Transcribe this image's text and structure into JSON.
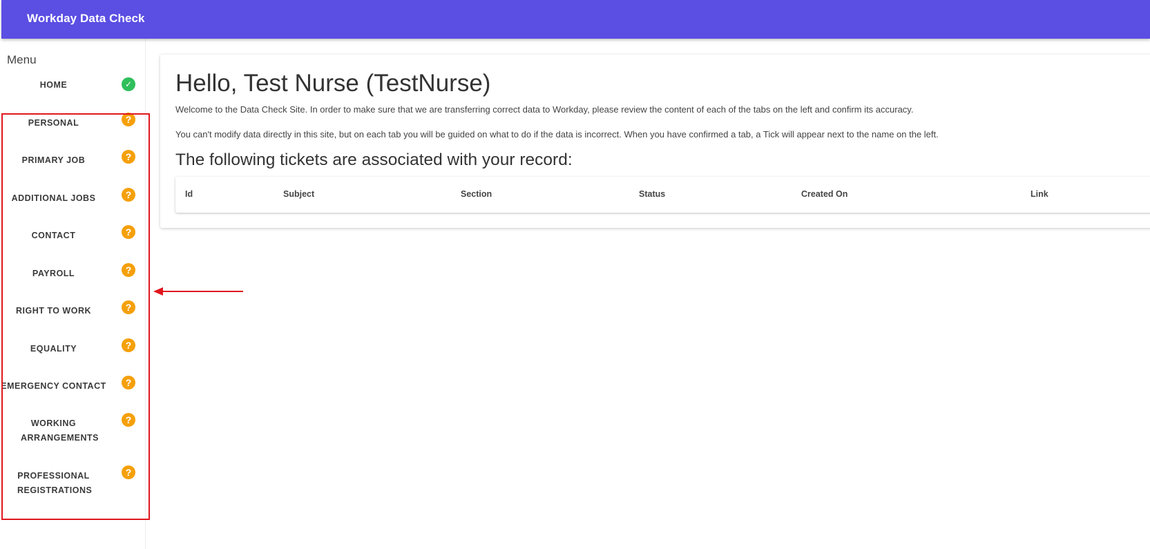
{
  "app": {
    "title": "Workday Data Check",
    "accent_color": "#5b4ee3"
  },
  "sidebar": {
    "heading": "Menu",
    "items": [
      {
        "label": "HOME",
        "status": "complete",
        "icon": "check-circle-icon"
      },
      {
        "label": "PERSONAL",
        "status": "pending",
        "icon": "question-circle-icon"
      },
      {
        "label": "PRIMARY JOB",
        "status": "pending",
        "icon": "question-circle-icon"
      },
      {
        "label": "ADDITIONAL JOBS",
        "status": "pending",
        "icon": "question-circle-icon"
      },
      {
        "label": "CONTACT",
        "status": "pending",
        "icon": "question-circle-icon"
      },
      {
        "label": "PAYROLL",
        "status": "pending",
        "icon": "question-circle-icon"
      },
      {
        "label": "RIGHT TO WORK",
        "status": "pending",
        "icon": "question-circle-icon"
      },
      {
        "label": "EQUALITY",
        "status": "pending",
        "icon": "question-circle-icon"
      },
      {
        "label": "EMERGENCY CONTACT",
        "status": "pending",
        "icon": "question-circle-icon"
      },
      {
        "label": "WORKING ARRANGEMENTS",
        "status": "pending",
        "icon": "question-circle-icon"
      },
      {
        "label": "PROFESSIONAL REGISTRATIONS",
        "status": "pending",
        "icon": "question-circle-icon"
      }
    ],
    "status_colors": {
      "complete": "#2fbf5b",
      "pending": "#f5a00a"
    }
  },
  "main": {
    "greeting": "Hello, Test Nurse (TestNurse)",
    "intro": "Welcome to the Data Check Site. In order to make sure that we are transferring correct data to Workday, please review the content of each of the tabs on the left and confirm its accuracy.",
    "note": "You can't modify data directly in this site, but on each tab you will be guided on what to do if the data is incorrect. When you have confirmed a tab, a Tick will appear next to the name on the left.",
    "tickets_heading": "The following tickets are associated with your record:",
    "tickets_table": {
      "columns": [
        "Id",
        "Subject",
        "Section",
        "Status",
        "Created On",
        "Link"
      ],
      "rows": []
    }
  },
  "annotation": {
    "highlight_color": "#e0161e"
  }
}
